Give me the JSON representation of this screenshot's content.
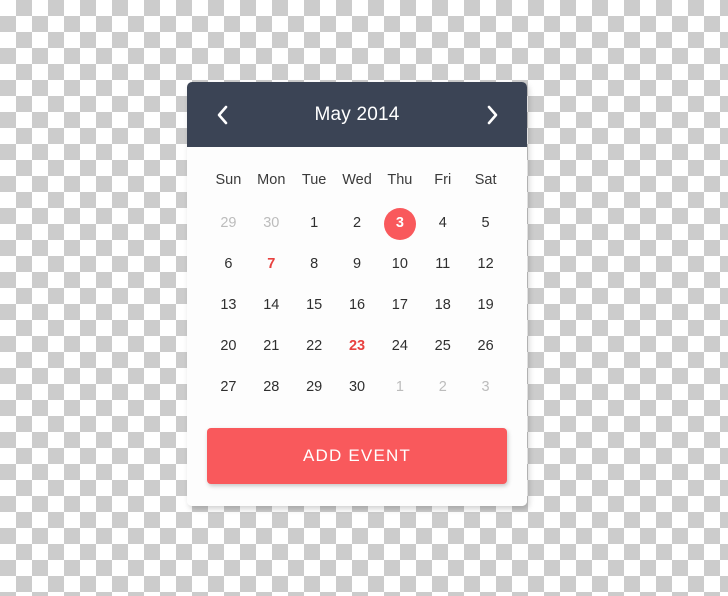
{
  "widget": {
    "name": "date-picker-calendar",
    "accent_color": "#f9595c",
    "header_color": "#3b4455",
    "event_color": "#e8413f",
    "muted_color": "#bcbcbc"
  },
  "header": {
    "title": "May 2014",
    "prev_label": "‹",
    "next_label": "›",
    "prev_icon": "chevron-left-icon",
    "next_icon": "chevron-right-icon"
  },
  "weekdays": [
    "Sun",
    "Mon",
    "Tue",
    "Wed",
    "Thu",
    "Fri",
    "Sat"
  ],
  "weeks": [
    [
      {
        "day": "29",
        "state": "muted"
      },
      {
        "day": "30",
        "state": "muted"
      },
      {
        "day": "1",
        "state": "normal"
      },
      {
        "day": "2",
        "state": "normal"
      },
      {
        "day": "3",
        "state": "selected"
      },
      {
        "day": "4",
        "state": "normal"
      },
      {
        "day": "5",
        "state": "normal"
      }
    ],
    [
      {
        "day": "6",
        "state": "normal"
      },
      {
        "day": "7",
        "state": "event"
      },
      {
        "day": "8",
        "state": "normal"
      },
      {
        "day": "9",
        "state": "normal"
      },
      {
        "day": "10",
        "state": "normal"
      },
      {
        "day": "11",
        "state": "normal"
      },
      {
        "day": "12",
        "state": "normal"
      }
    ],
    [
      {
        "day": "13",
        "state": "normal"
      },
      {
        "day": "14",
        "state": "normal"
      },
      {
        "day": "15",
        "state": "normal"
      },
      {
        "day": "16",
        "state": "normal"
      },
      {
        "day": "17",
        "state": "normal"
      },
      {
        "day": "18",
        "state": "normal"
      },
      {
        "day": "19",
        "state": "normal"
      }
    ],
    [
      {
        "day": "20",
        "state": "normal"
      },
      {
        "day": "21",
        "state": "normal"
      },
      {
        "day": "22",
        "state": "normal"
      },
      {
        "day": "23",
        "state": "event"
      },
      {
        "day": "24",
        "state": "normal"
      },
      {
        "day": "25",
        "state": "normal"
      },
      {
        "day": "26",
        "state": "normal"
      }
    ],
    [
      {
        "day": "27",
        "state": "normal"
      },
      {
        "day": "28",
        "state": "normal"
      },
      {
        "day": "29",
        "state": "normal"
      },
      {
        "day": "30",
        "state": "normal"
      },
      {
        "day": "1",
        "state": "muted"
      },
      {
        "day": "2",
        "state": "muted"
      },
      {
        "day": "3",
        "state": "muted"
      }
    ]
  ],
  "footer": {
    "add_event_label": "ADD EVENT"
  }
}
